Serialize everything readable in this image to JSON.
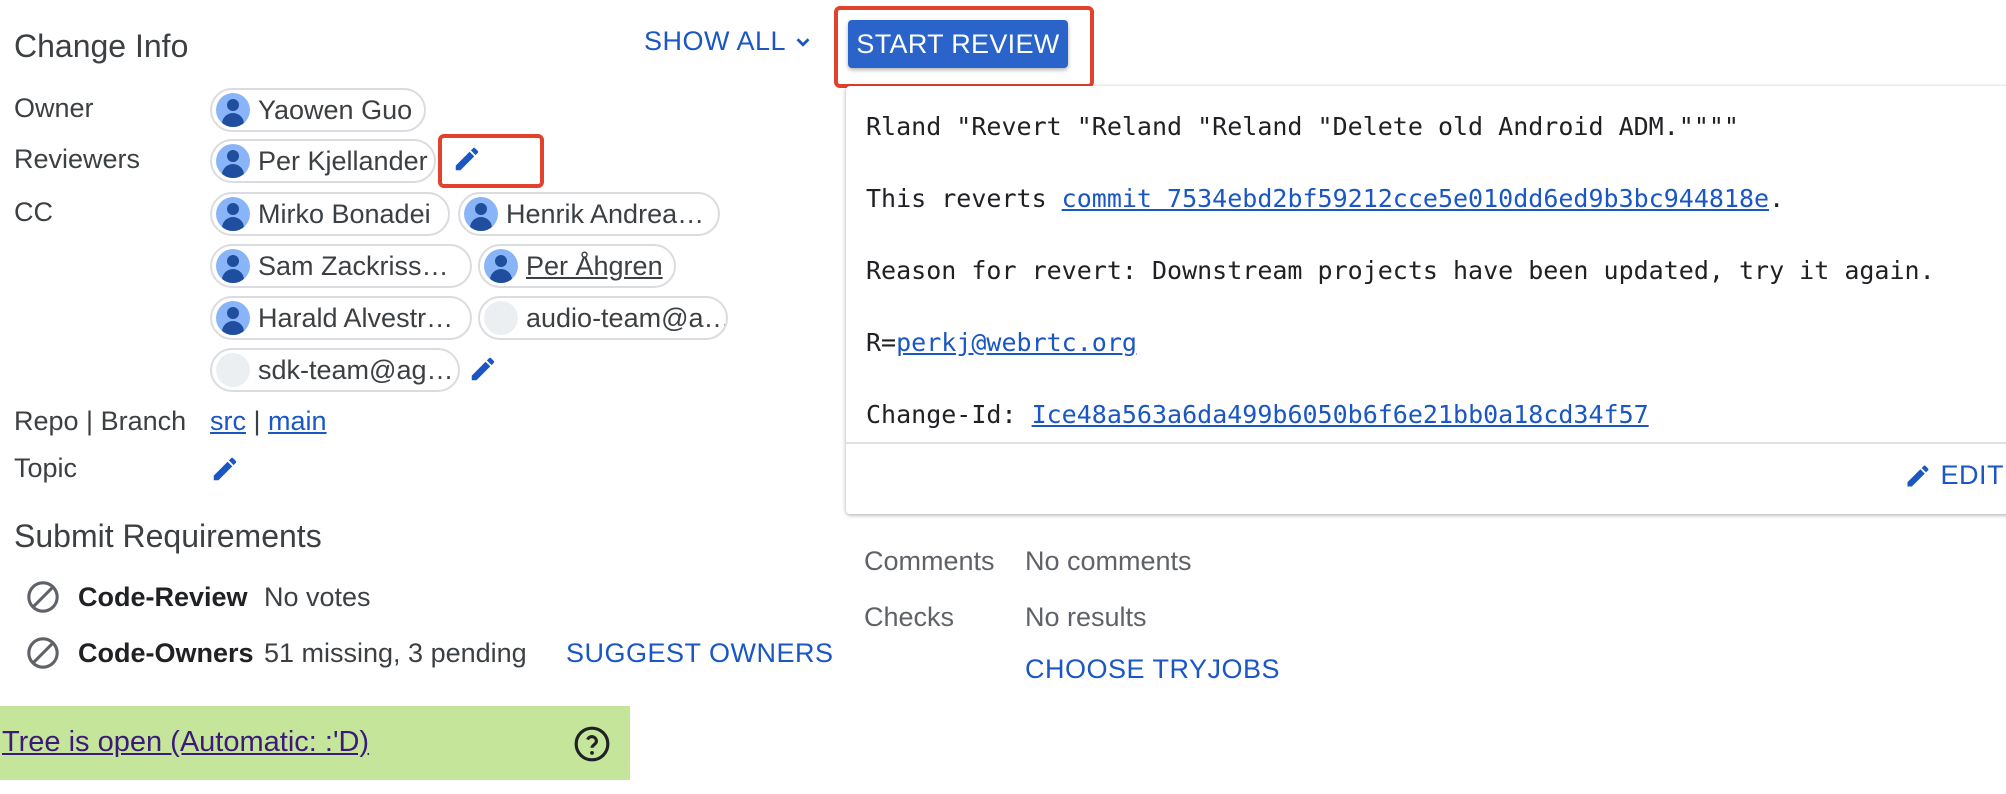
{
  "change_info": {
    "title": "Change Info",
    "show_all_label": "SHOW ALL",
    "owner_label": "Owner",
    "owner": "Yaowen Guo",
    "reviewers_label": "Reviewers",
    "reviewers": [
      "Per Kjellander"
    ],
    "cc_label": "CC",
    "cc": [
      "Mirko Bonadei",
      "Henrik Andrea…",
      "Sam Zackriss…",
      "Per Åhgren",
      "Harald Alvestr…",
      "audio-team@a…",
      "sdk-team@ag…"
    ],
    "repo_branch_label": "Repo | Branch",
    "repo": "src",
    "separator": "|",
    "branch": "main",
    "topic_label": "Topic"
  },
  "submit_requirements": {
    "title": "Submit Requirements",
    "items": [
      {
        "name": "Code-Review",
        "status": "No votes"
      },
      {
        "name": "Code-Owners",
        "status": "51 missing, 3 pending"
      }
    ],
    "suggest_owners_label": "SUGGEST OWNERS"
  },
  "tree_status": {
    "text": "Tree is open (Automatic: :'D)",
    "color": "#c5e59a"
  },
  "header": {
    "start_review_label": "START REVIEW"
  },
  "commit_message": {
    "subject": "Rland \"Revert \"Reland \"Reland \"Delete old Android ADM.\"\"\"\"",
    "reverts_prefix": "This reverts ",
    "reverts_link": "commit 7534ebd2bf59212cce5e010dd6ed9b3bc944818e",
    "reverts_suffix": ".",
    "reason": "Reason for revert: Downstream projects have been updated, try it again.",
    "r_prefix": "R=",
    "r_link": "perkj@webrtc.org",
    "change_id_prefix": "Change-Id: ",
    "change_id": "Ice48a563a6da499b6050b6f6e21bb0a18cd34f57",
    "edit_label": "EDIT"
  },
  "summary": {
    "comments_label": "Comments",
    "comments_value": "No comments",
    "checks_label": "Checks",
    "checks_value": "No results",
    "choose_tryjobs_label": "CHOOSE TRYJOBS"
  },
  "colors": {
    "accent": "#2a63c9",
    "link": "#1a56c4",
    "highlight": "#e2412c"
  }
}
